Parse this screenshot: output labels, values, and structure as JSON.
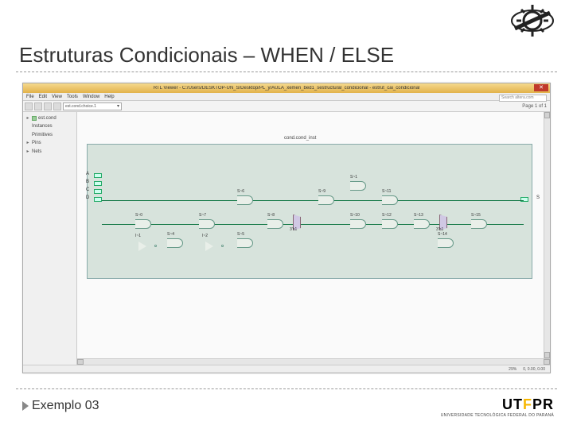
{
  "slide": {
    "title": "Estruturas Condicionais – WHEN / ELSE",
    "footer_caption": "Exemplo 03"
  },
  "window": {
    "title": "RTL Viewer - C:/Users/DESKTOP-UN_S/Desktop/PL_y/AULA_xemen_bed1_sestructural_condicional - estrut_cai_condicional",
    "close": "✕",
    "menu": [
      "File",
      "Edit",
      "View",
      "Tools",
      "Window",
      "Help"
    ],
    "search_placeholder": "Search altera.com",
    "page_nav": "Page 1 of 1",
    "toolbar": {
      "combo_value": "est.cond.choice.1",
      "chev": "▾"
    },
    "sidebar": {
      "items": [
        {
          "exp": "▸",
          "label": "est.cond"
        },
        {
          "exp": " ",
          "label": "Instances"
        },
        {
          "exp": " ",
          "label": "Primitives"
        },
        {
          "exp": "▸",
          "label": "Pins"
        },
        {
          "exp": "▸",
          "label": "Nets"
        }
      ]
    },
    "netlist_label": "cond.cond_inst",
    "ports": {
      "A": "A",
      "B": "B",
      "C": "C",
      "D": "D",
      "S": "S"
    },
    "gates": {
      "s0": "S~0",
      "s1": "S~1",
      "s4": "S~4",
      "s5": "S~5",
      "s6": "S~6",
      "s7": "S~7",
      "s8": "S~8",
      "s9": "S~9",
      "s10": "S~10",
      "s11": "S~11",
      "s12": "S~12",
      "s13": "S~13",
      "s14": "S~14",
      "s15": "S~15",
      "i0": "I~1",
      "i1": "I~2",
      "sl0": "3'h1",
      "sl1": "3'h1"
    },
    "status": {
      "zoom": "29%",
      "hint": "0, 0.00, 0.00"
    }
  },
  "utfpr": {
    "name": "UTFPR",
    "sub": "UNIVERSIDADE TECNOLÓGICA FEDERAL DO PARANÁ"
  },
  "chart_data": {
    "type": "diagram",
    "description": "RTL logic-gate schematic (Altera RTL Viewer)",
    "inputs": [
      "A",
      "B",
      "C",
      "D"
    ],
    "outputs": [
      "S"
    ],
    "blocks": [
      {
        "id": "S~0",
        "kind": "and2"
      },
      {
        "id": "I~1",
        "kind": "not"
      },
      {
        "id": "S~1",
        "kind": "and2"
      },
      {
        "id": "S~4",
        "kind": "and2"
      },
      {
        "id": "I~2",
        "kind": "not"
      },
      {
        "id": "S~5",
        "kind": "and2"
      },
      {
        "id": "S~6",
        "kind": "and2"
      },
      {
        "id": "S~7",
        "kind": "and2"
      },
      {
        "id": "S~8",
        "kind": "and2"
      },
      {
        "id": "S~9",
        "kind": "and2"
      },
      {
        "id": "3'h1_a",
        "kind": "mux"
      },
      {
        "id": "S~10",
        "kind": "and2"
      },
      {
        "id": "S~11",
        "kind": "and2"
      },
      {
        "id": "S~12",
        "kind": "and2"
      },
      {
        "id": "S~13",
        "kind": "and2"
      },
      {
        "id": "3'h1_b",
        "kind": "mux"
      },
      {
        "id": "S~14",
        "kind": "and2"
      },
      {
        "id": "S~15",
        "kind": "and2"
      }
    ],
    "note": "Topology approximated from low-resolution screenshot; block positions and exact wiring not fully legible."
  }
}
